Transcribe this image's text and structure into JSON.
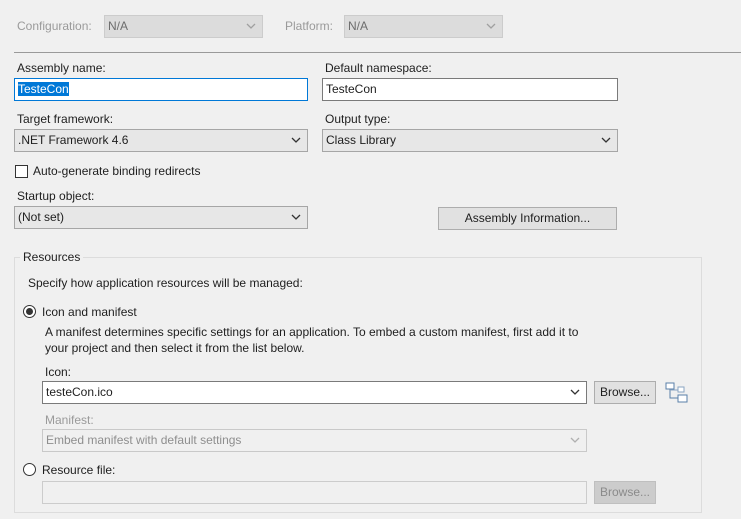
{
  "top_bar": {
    "configuration_label": "Configuration:",
    "configuration_value": "N/A",
    "platform_label": "Platform:",
    "platform_value": "N/A"
  },
  "assembly": {
    "name_label": "Assembly name:",
    "name_value": "TesteCon",
    "namespace_label": "Default namespace:",
    "namespace_value": "TesteCon"
  },
  "framework": {
    "target_label": "Target framework:",
    "target_value": ".NET Framework 4.6",
    "output_label": "Output type:",
    "output_value": "Class Library"
  },
  "auto_binding_label": "Auto-generate binding redirects",
  "startup": {
    "label": "Startup object:",
    "value": "(Not set)"
  },
  "assembly_info_button": "Assembly Information...",
  "resources": {
    "group_title": "Resources",
    "description": "Specify how application resources will be managed:",
    "icon_manifest_label": "Icon and manifest",
    "manifest_help_line1": "A manifest determines specific settings for an application. To embed a custom manifest, first add it to",
    "manifest_help_line2": "your project and then select it from the list below.",
    "icon_label": "Icon:",
    "icon_value": "testeCon.ico",
    "browse_label": "Browse...",
    "manifest_label": "Manifest:",
    "manifest_value": "Embed manifest with default settings",
    "resource_file_label": "Resource file:",
    "resource_file_value": "",
    "resource_browse_label": "Browse..."
  }
}
